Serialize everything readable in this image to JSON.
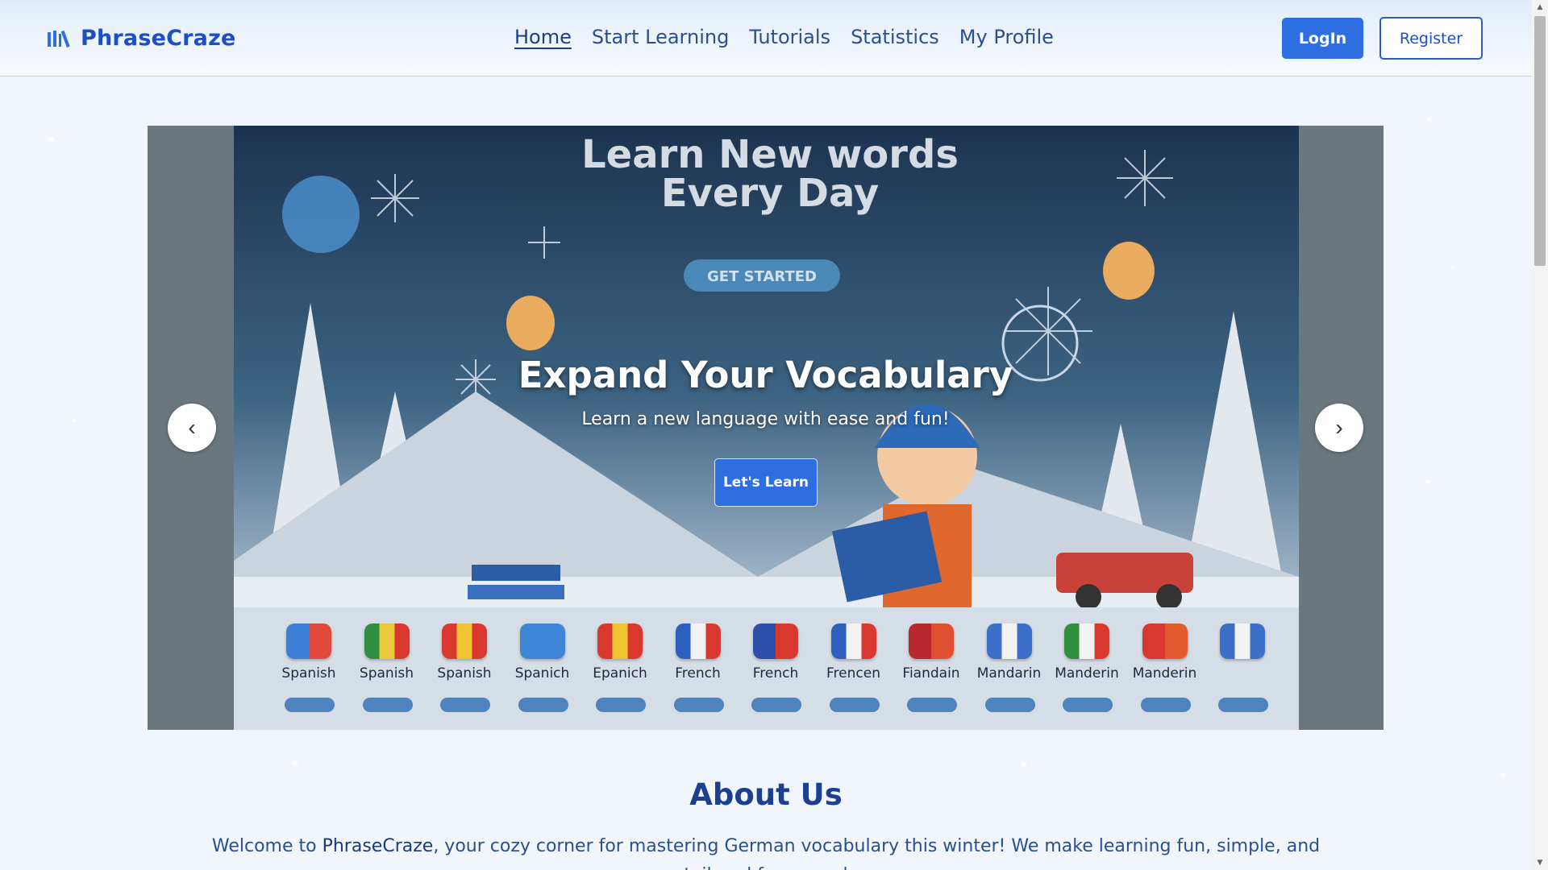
{
  "header": {
    "brand": "PhraseCraze",
    "nav": [
      {
        "label": "Home",
        "active": true
      },
      {
        "label": "Start Learning"
      },
      {
        "label": "Tutorials"
      },
      {
        "label": "Statistics"
      },
      {
        "label": "My Profile"
      }
    ],
    "login_label": "LogIn",
    "register_label": "Register"
  },
  "hero": {
    "banner_title_line1": "Learn New words",
    "banner_title_line2": "Every Day",
    "banner_button": "GET STARTED",
    "title": "Expand Your Vocabulary",
    "subtitle": "Learn a new language with ease and fun!",
    "cta_label": "Let's Learn",
    "prev_label": "‹",
    "next_label": "›",
    "language_cards": [
      {
        "label": "Spanish",
        "colors": [
          "#3b7fd8",
          "#e04a3c"
        ]
      },
      {
        "label": "Spanish",
        "colors": [
          "#2f8f3f",
          "#e9c93a",
          "#d8382e"
        ]
      },
      {
        "label": "Spanish",
        "colors": [
          "#d8382e",
          "#f0c331",
          "#d8382e"
        ]
      },
      {
        "label": "Spanich",
        "colors": [
          "#3d86d6",
          "#3d86d6"
        ]
      },
      {
        "label": "Epanich",
        "colors": [
          "#d8382e",
          "#f0c331",
          "#d8382e"
        ]
      },
      {
        "label": "French",
        "colors": [
          "#2e5fc0",
          "#f2f2f2",
          "#d8382e"
        ]
      },
      {
        "label": "French",
        "colors": [
          "#2e4fa8",
          "#d8382e"
        ]
      },
      {
        "label": "Frencen",
        "colors": [
          "#2e5fc0",
          "#f2f2f2",
          "#d8382e"
        ]
      },
      {
        "label": "Fiandain",
        "colors": [
          "#b8282e",
          "#e05030"
        ]
      },
      {
        "label": "Mandarin",
        "colors": [
          "#3b6fc8",
          "#f2f2f2",
          "#3b6fc8"
        ]
      },
      {
        "label": "Manderin",
        "colors": [
          "#2f8f3f",
          "#f2f2f2",
          "#d8382e"
        ]
      },
      {
        "label": "Manderin",
        "colors": [
          "#d8382e",
          "#e05a2e"
        ]
      },
      {
        "label": "",
        "colors": [
          "#3b6fc8",
          "#f2f2f2",
          "#3b6fc8"
        ]
      }
    ]
  },
  "about": {
    "title": "About Us",
    "text_before": "Welcome to ",
    "brand": "PhraseCraze",
    "text_after": ", your cozy corner for mastering German vocabulary this winter! We make learning fun, simple, and tailored for every l"
  },
  "colors": {
    "primary": "#2d6ee0",
    "brand": "#1d4fc4",
    "heading": "#1d3f90",
    "background": "#f1f6fc"
  },
  "icons": {
    "brand": "library-books-icon",
    "prev": "chevron-left-icon",
    "next": "chevron-right-icon"
  }
}
